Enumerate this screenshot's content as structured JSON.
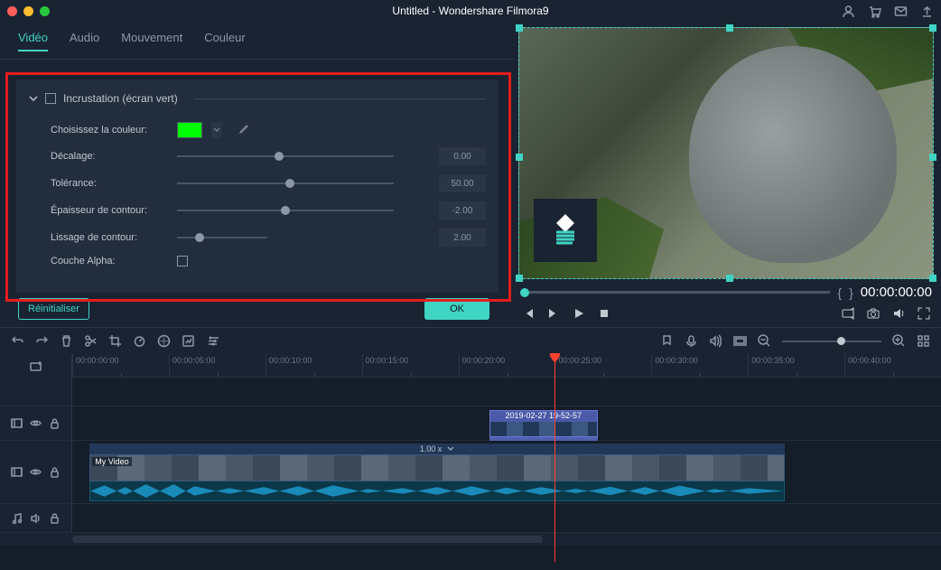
{
  "title": "Untitled - Wondershare Filmora9",
  "tabs": {
    "video": "Vidéo",
    "audio": "Audio",
    "motion": "Mouvement",
    "color": "Couleur"
  },
  "chroma": {
    "section_title": "Incrustation (écran vert)",
    "choose_color": "Choisissez la couleur:",
    "color": "#00ff00",
    "offset_label": "Décalage:",
    "offset_value": "0.00",
    "tolerance_label": "Tolérance:",
    "tolerance_value": "50.00",
    "edge_thickness_label": "Épaisseur de contour:",
    "edge_thickness_value": "-2.00",
    "edge_feather_label": "Lissage de contour:",
    "edge_feather_value": "2.00",
    "alpha_label": "Couche Alpha:"
  },
  "buttons": {
    "reset": "Réinitialiser",
    "ok": "OK"
  },
  "preview": {
    "time": "00:00:00:00"
  },
  "timeline": {
    "ruler": [
      "00:00:00:00",
      "00:00:05:00",
      "00:00:10:00",
      "00:00:15:00",
      "00:00:20:00",
      "00:00:25:00",
      "00:00:30:00",
      "00:00:35:00",
      "00:00:40:00"
    ],
    "overlay_clip_label": "2019-02-27 19-52-57",
    "video_speed": "1.00 x",
    "video_clip_label": "My Video"
  }
}
